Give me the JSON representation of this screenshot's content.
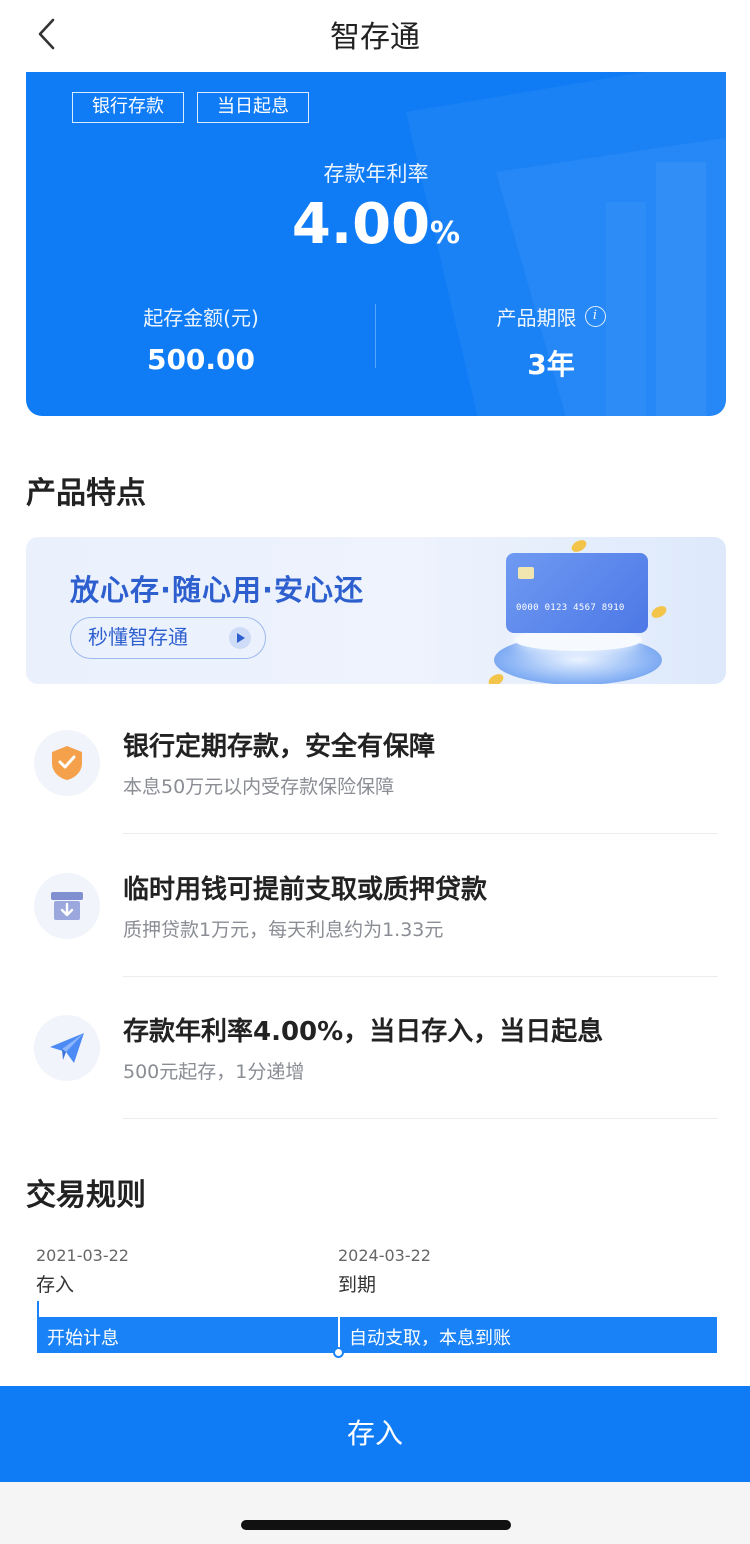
{
  "nav": {
    "title": "智存通"
  },
  "hero": {
    "tags": [
      "银行存款",
      "当日起息"
    ],
    "rate_label": "存款年利率",
    "rate_value": "4.00",
    "rate_unit": "%",
    "min_amount_label": "起存金额(元)",
    "min_amount_value": "500.00",
    "term_label": "产品期限",
    "term_value": "3年"
  },
  "features_section": {
    "title": "产品特点",
    "banner": {
      "slogan": "放心存·随心用·安心还",
      "button_label": "秒懂智存通",
      "card_number": "0000 0123 4567 8910"
    },
    "items": [
      {
        "icon": "shield-check-icon",
        "title": "银行定期存款，安全有保障",
        "subtitle": "本息50万元以内受存款保险保障"
      },
      {
        "icon": "archive-box-icon",
        "title": "临时用钱可提前支取或质押贷款",
        "subtitle": "质押贷款1万元，每天利息约为1.33元"
      },
      {
        "icon": "paper-plane-icon",
        "title": "存款年利率4.00%，当日存入，当日起息",
        "subtitle": "500元起存，1分递增"
      }
    ]
  },
  "rules_section": {
    "title": "交易规则",
    "timeline": [
      {
        "date": "2021-03-22",
        "label": "存入",
        "bar_text": "开始计息"
      },
      {
        "date": "2024-03-22",
        "label": "到期",
        "bar_text": "自动支取，本息到账"
      }
    ]
  },
  "footer": {
    "deposit_label": "存入"
  },
  "colors": {
    "primary": "#0F7CF6",
    "banner_text": "#2D5FCF",
    "shield": "#F5A04A"
  }
}
